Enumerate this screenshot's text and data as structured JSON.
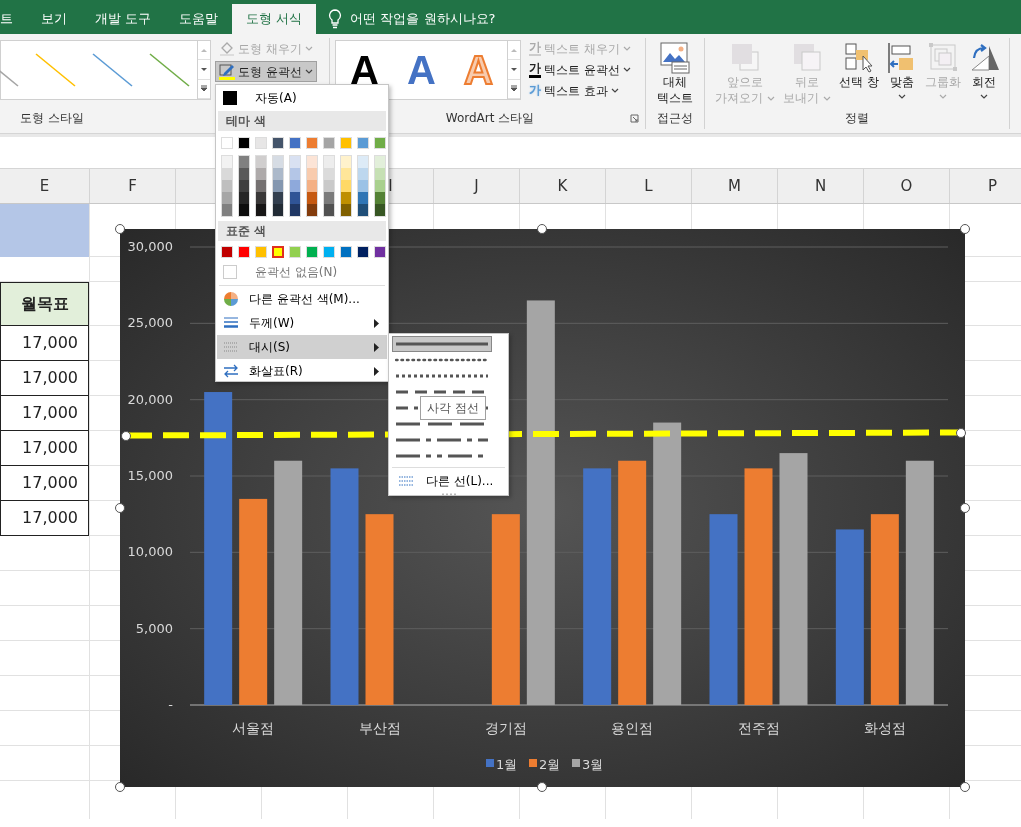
{
  "tabs": [
    {
      "label": "트",
      "selected": false
    },
    {
      "label": "보기",
      "selected": false
    },
    {
      "label": "개발 도구",
      "selected": false
    },
    {
      "label": "도움말",
      "selected": false
    },
    {
      "label": "도형 서식",
      "selected": true
    }
  ],
  "tell_me": {
    "text": "어떤 작업을 원하시나요?"
  },
  "ribbon": {
    "shape_styles": {
      "label": "도형 스타일",
      "previews": [
        {
          "color": "#a5a5a5"
        },
        {
          "color": "#ffc000"
        },
        {
          "color": "#5b9bd5"
        },
        {
          "color": "#70ad47"
        }
      ],
      "fill": {
        "label": "도형 채우기",
        "disabled": true
      },
      "outline": {
        "label": "도형 윤곽선",
        "pressed": true
      }
    },
    "wordart": {
      "label": "WordArt 스타일",
      "styles": [
        {
          "glyph": "A",
          "kind": "solid"
        },
        {
          "glyph": "A",
          "kind": "blue"
        },
        {
          "glyph": "A",
          "kind": "outline"
        }
      ],
      "commands": [
        {
          "glyph": "가",
          "label": "텍스트 채우기",
          "disabled": true,
          "kind": "fill"
        },
        {
          "glyph": "가",
          "label": "텍스트 윤곽선",
          "disabled": false,
          "kind": "outline"
        },
        {
          "glyph": "가",
          "label": "텍스트 효과",
          "disabled": false,
          "kind": "effects"
        }
      ]
    },
    "accessibility": {
      "label": "접근성",
      "button": [
        "대체",
        "텍스트"
      ]
    },
    "arrange": {
      "label": "정렬",
      "buttons": [
        {
          "kind": "forward",
          "lines": [
            "앞으로",
            "가져오기"
          ],
          "disabled": true,
          "caret": true
        },
        {
          "kind": "backward",
          "lines": [
            "뒤로",
            "보내기"
          ],
          "disabled": true,
          "caret": true
        },
        {
          "kind": "selection",
          "lines": [
            "선택 창"
          ],
          "disabled": false,
          "caret": false
        },
        {
          "kind": "align",
          "lines": [
            "맞춤"
          ],
          "disabled": false,
          "caret": true
        },
        {
          "kind": "group",
          "lines": [
            "그룹화"
          ],
          "disabled": true,
          "caret": true
        },
        {
          "kind": "rotate",
          "lines": [
            "회전"
          ],
          "disabled": false,
          "caret": true
        }
      ]
    }
  },
  "sheet": {
    "columns": [
      {
        "label": "E"
      },
      {
        "label": "F"
      },
      {},
      {},
      {
        "label": "I"
      },
      {
        "label": "J"
      },
      {
        "label": "K"
      },
      {
        "label": "L"
      },
      {
        "label": "M"
      },
      {
        "label": "N"
      },
      {
        "label": "O"
      },
      {
        "label": "P"
      }
    ],
    "column_e": [
      {
        "kind": "fill"
      },
      {
        "kind": "blank"
      },
      {
        "kind": "header",
        "text": "월목표"
      },
      {
        "kind": "value",
        "text": "17,000"
      },
      {
        "kind": "value",
        "text": "17,000"
      },
      {
        "kind": "value",
        "text": "17,000"
      },
      {
        "kind": "value",
        "text": "17,000"
      },
      {
        "kind": "value",
        "text": "17,000"
      },
      {
        "kind": "value",
        "text": "17,000"
      }
    ]
  },
  "chart": {
    "chart_data": {
      "type": "bar",
      "categories": [
        "서울점",
        "부산점",
        "경기점",
        "용인점",
        "전주점",
        "화성점"
      ],
      "series": [
        {
          "name": "1월",
          "color": "#4472c4",
          "values": [
            20500,
            15500,
            null,
            15500,
            12500,
            11500
          ]
        },
        {
          "name": "2월",
          "color": "#ed7d31",
          "values": [
            13500,
            12500,
            12500,
            16000,
            15500,
            12500
          ]
        },
        {
          "name": "3월",
          "color": "#a5a5a5",
          "values": [
            16000,
            null,
            26500,
            18500,
            16500,
            16000
          ]
        }
      ],
      "ylim": [
        0,
        30000
      ],
      "grid": true,
      "legend": true,
      "yticks": [
        {
          "value": 0,
          "label": "-"
        },
        {
          "value": 5000,
          "label": "5,000"
        },
        {
          "value": 10000,
          "label": "10,000"
        },
        {
          "value": 15000,
          "label": "15,000"
        },
        {
          "value": 20000,
          "label": "20,000"
        },
        {
          "value": 25000,
          "label": "25,000"
        },
        {
          "value": 30000,
          "label": "30,000"
        }
      ]
    }
  },
  "outline_menu": {
    "automatic": "자동(A)",
    "theme_header": "테마 색",
    "theme_colors": [
      {
        "color": "#ffffff",
        "selected": false,
        "shades": [
          {
            "color": "#f2f2f2",
            "selected": false
          },
          {
            "color": "#d9d9d9",
            "selected": false
          },
          {
            "color": "#bfbfbf",
            "selected": false
          },
          {
            "color": "#a6a6a6",
            "selected": false
          },
          {
            "color": "#808080",
            "selected": false
          }
        ]
      },
      {
        "color": "#000000",
        "selected": false,
        "shades": [
          {
            "color": "#808080",
            "selected": false
          },
          {
            "color": "#595959",
            "selected": false
          },
          {
            "color": "#404040",
            "selected": false
          },
          {
            "color": "#262626",
            "selected": false
          },
          {
            "color": "#0d0d0d",
            "selected": false
          }
        ]
      },
      {
        "color": "#e7e6e6",
        "selected": false,
        "shades": [
          {
            "color": "#d0cece",
            "selected": false
          },
          {
            "color": "#aeaaaa",
            "selected": false
          },
          {
            "color": "#757171",
            "selected": false
          },
          {
            "color": "#3a3838",
            "selected": false
          },
          {
            "color": "#171616",
            "selected": false
          }
        ]
      },
      {
        "color": "#44546a",
        "selected": false,
        "shades": [
          {
            "color": "#d6dce4",
            "selected": false
          },
          {
            "color": "#acb9ca",
            "selected": false
          },
          {
            "color": "#8497b0",
            "selected": false
          },
          {
            "color": "#333f4f",
            "selected": false
          },
          {
            "color": "#222b35",
            "selected": false
          }
        ]
      },
      {
        "color": "#4472c4",
        "selected": false,
        "shades": [
          {
            "color": "#d9e1f2",
            "selected": false
          },
          {
            "color": "#b4c6e7",
            "selected": false
          },
          {
            "color": "#8ea9db",
            "selected": false
          },
          {
            "color": "#305496",
            "selected": false
          },
          {
            "color": "#203764",
            "selected": false
          }
        ]
      },
      {
        "color": "#ed7d31",
        "selected": false,
        "shades": [
          {
            "color": "#fce4d6",
            "selected": false
          },
          {
            "color": "#f8cbad",
            "selected": false
          },
          {
            "color": "#f4b084",
            "selected": false
          },
          {
            "color": "#c65911",
            "selected": false
          },
          {
            "color": "#833c0c",
            "selected": false
          }
        ]
      },
      {
        "color": "#a5a5a5",
        "selected": false,
        "shades": [
          {
            "color": "#ededed",
            "selected": false
          },
          {
            "color": "#dbdbdb",
            "selected": false
          },
          {
            "color": "#c9c9c9",
            "selected": false
          },
          {
            "color": "#7b7b7b",
            "selected": false
          },
          {
            "color": "#525252",
            "selected": false
          }
        ]
      },
      {
        "color": "#ffc000",
        "selected": false,
        "shades": [
          {
            "color": "#fff2cc",
            "selected": false
          },
          {
            "color": "#ffe699",
            "selected": false
          },
          {
            "color": "#ffd966",
            "selected": false
          },
          {
            "color": "#bf8f00",
            "selected": false
          },
          {
            "color": "#806000",
            "selected": false
          }
        ]
      },
      {
        "color": "#5b9bd5",
        "selected": false,
        "shades": [
          {
            "color": "#ddebf7",
            "selected": false
          },
          {
            "color": "#bdd7ee",
            "selected": false
          },
          {
            "color": "#9bc2e6",
            "selected": false
          },
          {
            "color": "#2f75b5",
            "selected": false
          },
          {
            "color": "#1f4e78",
            "selected": false
          }
        ]
      },
      {
        "color": "#70ad47",
        "selected": false,
        "shades": [
          {
            "color": "#e2efda",
            "selected": false
          },
          {
            "color": "#c6e0b4",
            "selected": false
          },
          {
            "color": "#a9d08e",
            "selected": false
          },
          {
            "color": "#548235",
            "selected": false
          },
          {
            "color": "#375623",
            "selected": false
          }
        ]
      }
    ],
    "standard_header": "표준 색",
    "standard_colors": [
      {
        "color": "#c00000",
        "selected": false
      },
      {
        "color": "#ff0000",
        "selected": false
      },
      {
        "color": "#ffc000",
        "selected": false
      },
      {
        "color": "#ffff00",
        "selected": true
      },
      {
        "color": "#92d050",
        "selected": false
      },
      {
        "color": "#00b050",
        "selected": false
      },
      {
        "color": "#00b0f0",
        "selected": false
      },
      {
        "color": "#0070c0",
        "selected": false
      },
      {
        "color": "#002060",
        "selected": false
      },
      {
        "color": "#7030a0",
        "selected": false
      }
    ],
    "no_outline": "윤곽선 없음(N)",
    "items": [
      {
        "kind": "colors",
        "label": "다른 윤곽선 색(M)...",
        "submenu": false,
        "selected": false
      },
      {
        "kind": "weight",
        "label": "두께(W)",
        "submenu": true,
        "selected": false
      },
      {
        "kind": "dash",
        "label": "대시(S)",
        "submenu": true,
        "selected": true
      },
      {
        "kind": "arrows",
        "label": "화살표(R)",
        "submenu": true,
        "selected": false
      }
    ]
  },
  "dash_menu": {
    "styles": [
      {
        "kind": "solid",
        "selected": true
      },
      {
        "kind": "round-dot",
        "selected": false
      },
      {
        "kind": "square-dot",
        "selected": false
      },
      {
        "kind": "dash",
        "selected": false
      },
      {
        "kind": "dash-dot",
        "selected": false
      },
      {
        "kind": "long-dash",
        "selected": false
      },
      {
        "kind": "long-dash-dot",
        "selected": false
      },
      {
        "kind": "long-dash-dot-dot",
        "selected": false
      }
    ],
    "more": "다른 선(L)..."
  },
  "tooltip": "사각 점선"
}
